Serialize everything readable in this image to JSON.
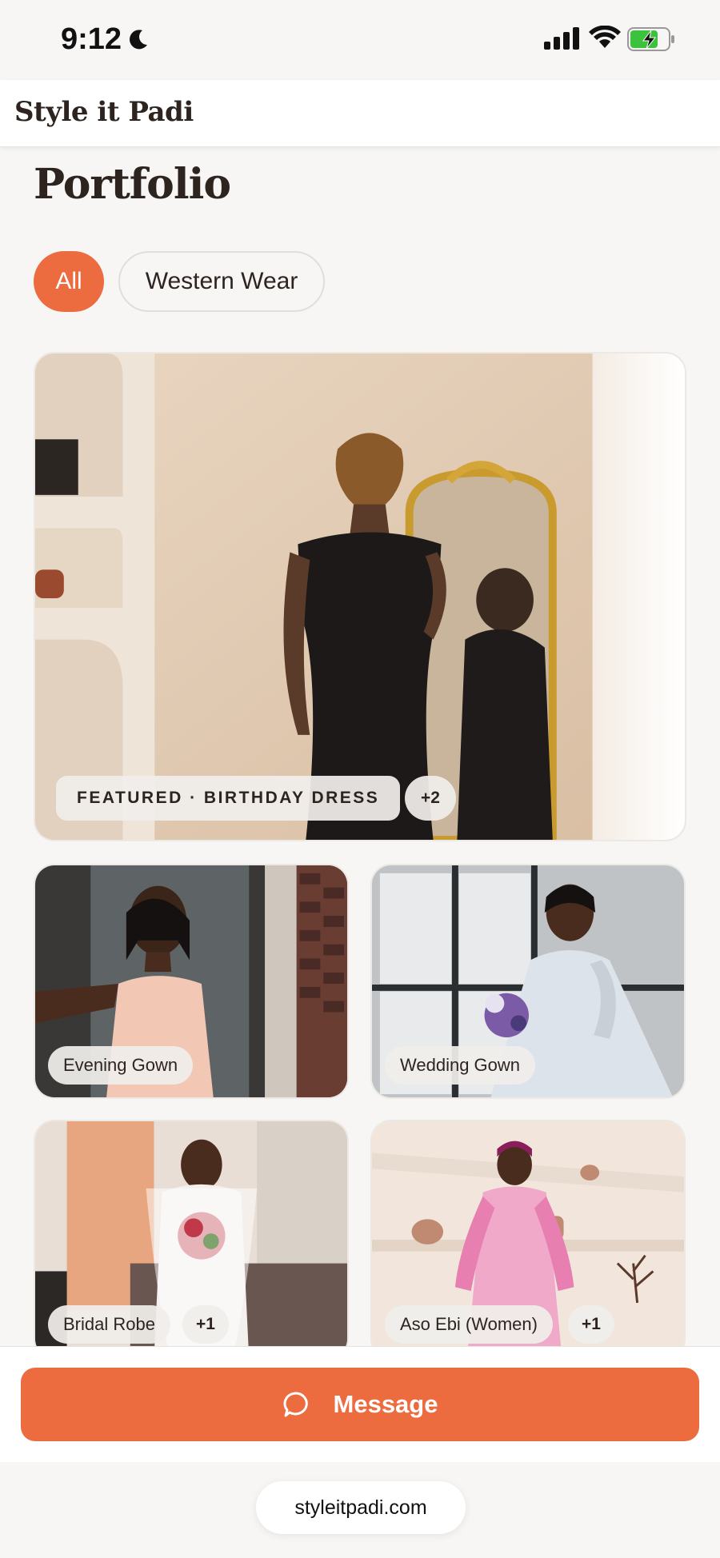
{
  "status_bar": {
    "time": "9:12",
    "battery_color": "#3cc23c"
  },
  "header": {
    "brand": "Style it Padi"
  },
  "page": {
    "title": "Portfolio"
  },
  "filters": [
    {
      "label": "All",
      "selected": true
    },
    {
      "label": "Western Wear",
      "selected": false
    }
  ],
  "portfolio": {
    "featured": {
      "label": "FEATURED · BIRTHDAY DRESS",
      "extra_count": "+2"
    },
    "items": [
      {
        "label": "Evening Gown",
        "extra_count": ""
      },
      {
        "label": "Wedding Gown",
        "extra_count": ""
      },
      {
        "label": "Bridal Robe",
        "extra_count": "+1"
      },
      {
        "label": "Aso Ebi (Women)",
        "extra_count": "+1"
      }
    ]
  },
  "actions": {
    "message_label": "Message"
  },
  "browser": {
    "url": "styleitpadi.com"
  },
  "colors": {
    "accent": "#ec6b3f",
    "background": "#f7f6f4",
    "text": "#2d2420"
  }
}
